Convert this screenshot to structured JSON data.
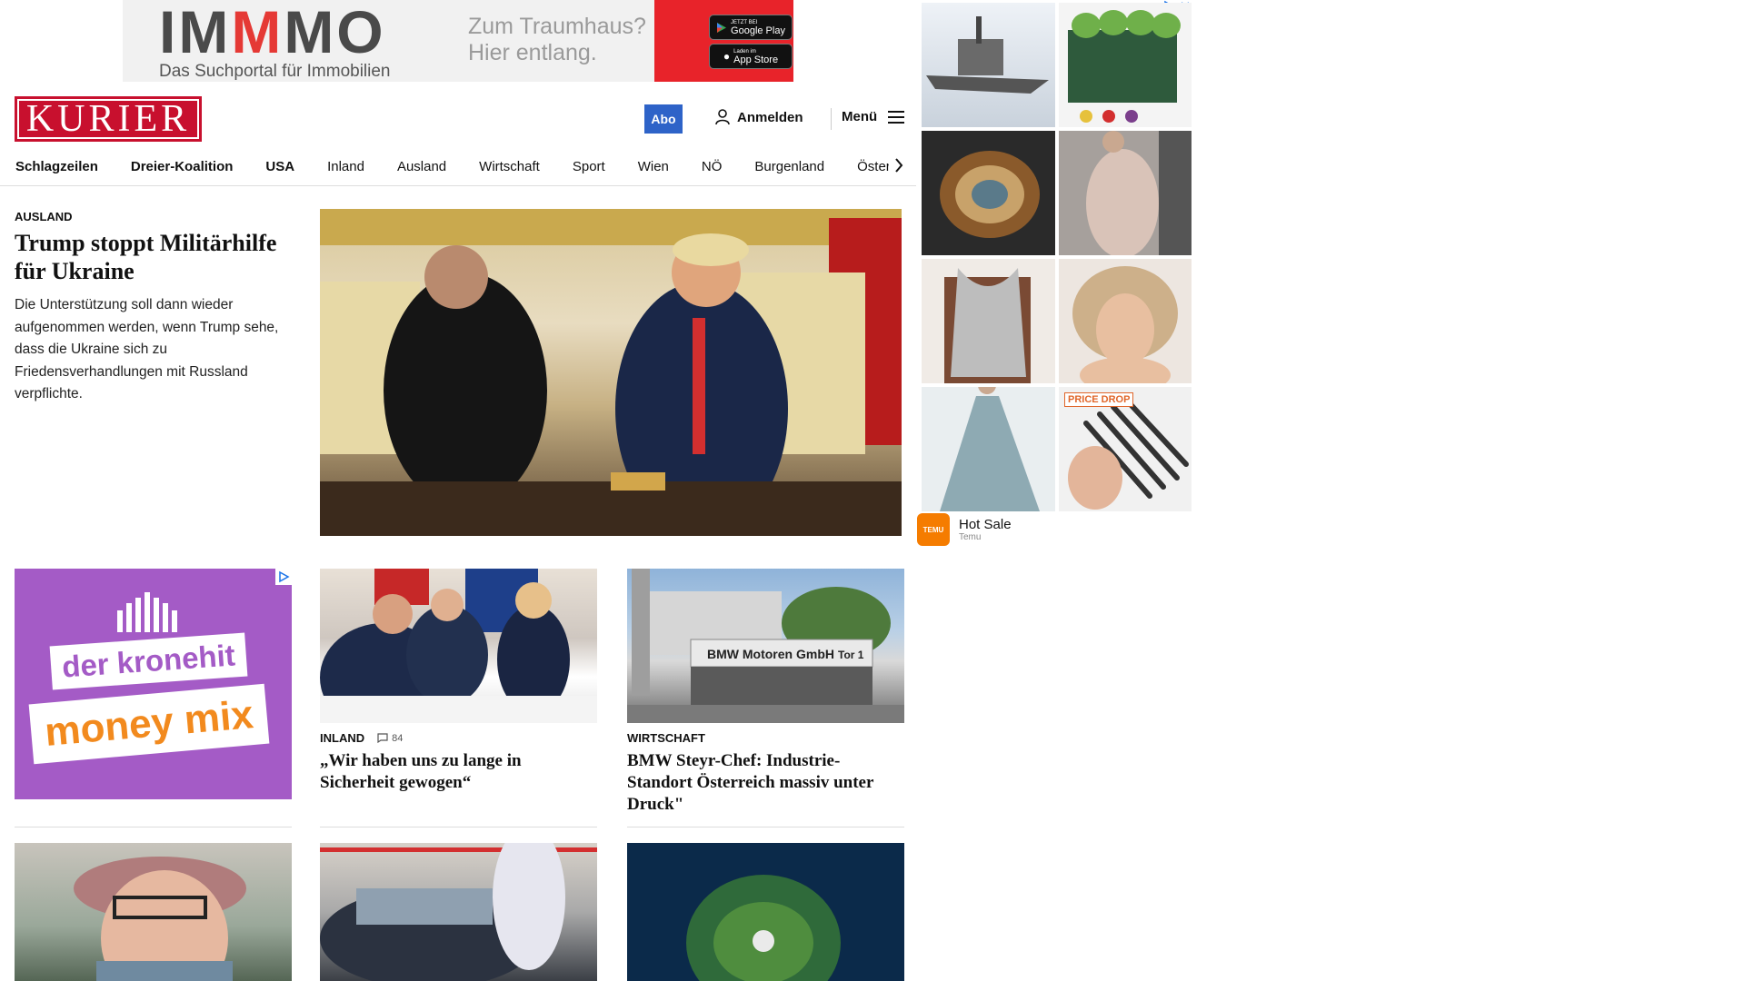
{
  "banner_ad": {
    "brand_part1": "IM",
    "brand_part2": "M",
    "brand_part3": "MO",
    "tagline": "Das Suchportal für Immobilien",
    "claim_line1": "Zum Traumhaus?",
    "claim_line2": "Hier entlang.",
    "google_play_small": "JETZT BEI",
    "google_play": "Google Play",
    "app_store_small": "Laden im",
    "app_store": "App Store"
  },
  "header": {
    "logo": "KURIER",
    "abo": "Abo",
    "login": "Anmelden",
    "menu": "Menü"
  },
  "nav": {
    "items": [
      "Schlagzeilen",
      "Dreier-Koalition",
      "USA",
      "Inland",
      "Ausland",
      "Wirtschaft",
      "Sport",
      "Wien",
      "NÖ",
      "Burgenland",
      "Österre"
    ]
  },
  "lead": {
    "kicker": "AUSLAND",
    "title": "Trump stoppt Militärhilfe für Ukraine",
    "teaser": "Die Unterstützung soll dann wieder aufgenommen werden, wenn Trump sehe, dass die Ukraine sich zu Friedensverhandlungen mit Russland verpflichte."
  },
  "kronehit_ad": {
    "line1": "der kronehit",
    "line2": "money mix"
  },
  "cards": [
    {
      "kicker": "INLAND",
      "comments": "84",
      "title": "„Wir haben uns zu lange in Sicherheit gewogen“"
    },
    {
      "kicker": "WIRTSCHAFT",
      "title": "BMW Steyr-Chef: Industrie-Standort Österreich massiv unter Druck\""
    }
  ],
  "bmw_sign": {
    "text": "BMW Motoren GmbH",
    "gate": "Tor 1"
  },
  "side_ad": {
    "price_drop": "PRICE DROP",
    "title": "Hot Sale",
    "source": "Temu",
    "logo_text": "TEMU"
  },
  "colors": {
    "brand_red": "#c8102e",
    "abo_blue": "#2e63c8",
    "immmo_red": "#e8232a",
    "kronehit_purple": "#a45bc6"
  }
}
